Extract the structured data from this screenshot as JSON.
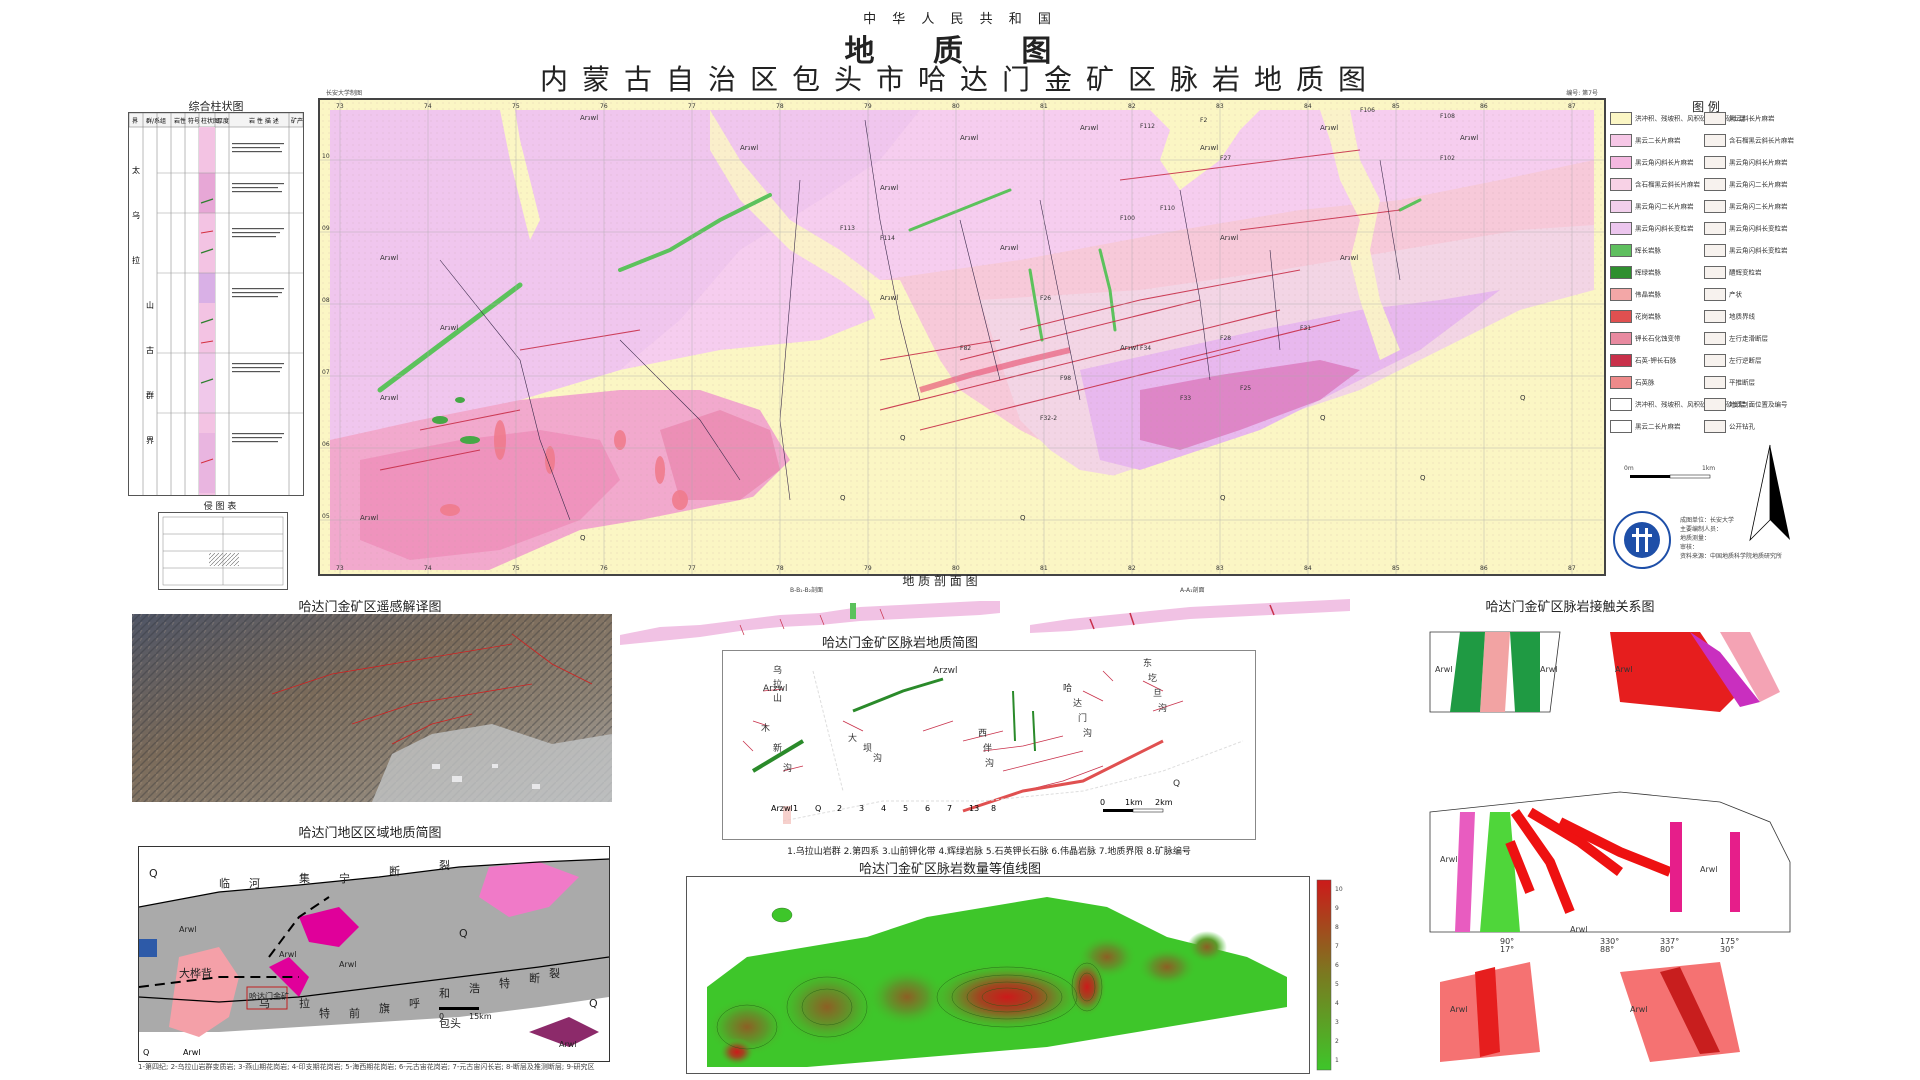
{
  "header": {
    "country": "中 华 人 民 共 和 国",
    "title": "地 质 图",
    "subtitle": "内蒙古自治区包头市哈达门金矿区脉岩地质图"
  },
  "column": {
    "title": "综合柱状图",
    "headers": [
      "界",
      "群/系",
      "组",
      "岩性",
      "符号",
      "柱状图",
      "厚度",
      "岩 性 描 述",
      "矿产"
    ],
    "units": [
      "太",
      "乌",
      "拉",
      "山",
      "古",
      "群",
      "界"
    ],
    "bottom_title": "侵 图 表"
  },
  "main_map": {
    "corner_note": "长安大学制图",
    "sheet_number": "编号: 第7号",
    "top_ticks": [
      "73",
      "74",
      "75",
      "76",
      "77",
      "78",
      "79",
      "80",
      "81",
      "82",
      "83",
      "84",
      "85",
      "86",
      "87"
    ],
    "bottom_ticks": [
      "73",
      "74",
      "75",
      "76",
      "77",
      "78",
      "79",
      "80",
      "81",
      "82",
      "83",
      "84",
      "85",
      "86",
      "87"
    ],
    "left_ticks": [
      "10",
      "09",
      "08",
      "07",
      "06",
      "05"
    ],
    "labels": {
      "q": "Q",
      "arzwl": "Ar₃wl",
      "faults": [
        "F112",
        "F2",
        "F106",
        "F108",
        "F27",
        "F113",
        "F114",
        "F110",
        "F100",
        "F31",
        "F28",
        "F26",
        "F82",
        "F98",
        "F32-2",
        "F34",
        "F33",
        "F25",
        "F102"
      ]
    }
  },
  "legend": {
    "title": "图 例",
    "left_items": [
      {
        "code": "Q",
        "label": "洪冲积、残坡积、风积砂砾石、砂土层",
        "color": "#fbf6c4"
      },
      {
        "code": "",
        "label": "黑云二长片麻岩",
        "color": "#f6c7e6"
      },
      {
        "code": "",
        "label": "黑云角闪斜长片麻岩",
        "color": "#f4b8e0"
      },
      {
        "code": "",
        "label": "含石榴黑云斜长片麻岩",
        "color": "#f8d2e6"
      },
      {
        "code": "",
        "label": "黑云角闪二长片麻岩",
        "color": "#f2cfec"
      },
      {
        "code": "",
        "label": "黑云角闪斜长变粒岩",
        "color": "#ecc6ee"
      },
      {
        "code": "",
        "label": "辉长岩脉",
        "color": "#5fbf5f"
      },
      {
        "code": "",
        "label": "辉绿岩脉",
        "color": "#2f8f2f"
      },
      {
        "code": "",
        "label": "伟晶岩脉",
        "color": "#f3a7a7"
      },
      {
        "code": "",
        "label": "花岗岩脉",
        "color": "#e05050"
      },
      {
        "code": "",
        "label": "钾长石化蚀变带",
        "color": "#e88aa0"
      },
      {
        "code": "",
        "label": "石英-钾长石脉",
        "color": "#c8304a"
      },
      {
        "code": "",
        "label": "石英脉",
        "color": "#ee8a8a"
      },
      {
        "code": "",
        "label": "洪冲积、残坡积、风积砂砾石、砂土层",
        "color": "#ffffff"
      },
      {
        "code": "",
        "label": "黑云二长片麻岩",
        "color": "#ffffff"
      }
    ],
    "right_items": [
      "黑云斜长片麻岩",
      "含石榴黑云斜长片麻岩",
      "黑云角闪斜长片麻岩",
      "黑云角闪二长片麻岩",
      "黑云角闪二长片麻岩",
      "黑云角闪斜长变粒岩",
      "黑云角闪斜长变粒岩",
      "醴辉变粒岩",
      "产状",
      "地质界线",
      "左行走滑断层",
      "左行逆断层",
      "平推断层",
      "地质剖面位置及编号",
      "公开钻孔"
    ],
    "scale_left": "0m",
    "scale_right": "1km",
    "credits": [
      "成图单位：长安大学",
      "主要编制人员：",
      "地质测量：",
      "审核：",
      "资料来源：中国地质科学院地质研究所"
    ]
  },
  "section": {
    "title": "地 质 剖 面 图",
    "left_label": "B-B₁-B₂剖面",
    "right_label": "A-A₁剖面"
  },
  "remote": {
    "title": "哈达门金矿区遥感解译图"
  },
  "dike_map": {
    "title": "哈达门金矿区脉岩地质简图",
    "labels": [
      "乌",
      "拉",
      "山",
      "木",
      "新",
      "沟",
      "大",
      "坝",
      "沟",
      "西",
      "伴",
      "沟",
      "哈",
      "达",
      "门",
      "沟",
      "东",
      "圪",
      "旦",
      "沟",
      "Arzwl",
      "Arzwl",
      "Q"
    ],
    "legend": [
      "Arzwl",
      "1",
      "Q",
      "2",
      "3",
      "4",
      "5",
      "6",
      "7",
      "13",
      "8"
    ],
    "scale": [
      "0",
      "1km",
      "2km"
    ],
    "caption": "1.乌拉山岩群  2.第四系  3.山前钾化带  4.辉绿岩脉  5.石英钾长石脉  6.伟晶岩脉  7.地质界限  8.矿脉编号"
  },
  "contour": {
    "title": "哈达门金矿区脉岩数量等值线图",
    "scale_values": [
      "10",
      "9",
      "8",
      "7",
      "6",
      "5",
      "4",
      "3",
      "2",
      "1"
    ]
  },
  "region": {
    "title": "哈达门地区区域地质简图",
    "labels": [
      "Q",
      "临",
      "河",
      "集",
      "宁",
      "断",
      "裂",
      "Arwl",
      "Arwl",
      "Arwl",
      "大桦背",
      "乌",
      "拉",
      "特",
      "前",
      "旗",
      "呼",
      "和",
      "浩",
      "特",
      "断",
      "裂",
      "Q",
      "Q",
      "包头",
      "Arwl",
      "哈达门金矿"
    ],
    "scale": [
      "0",
      "15km"
    ],
    "legend": [
      "Q",
      "Arwl"
    ],
    "caption": "1-第四纪; 2-乌拉山岩群变质岩; 3-燕山期花岗岩; 4-印支期花岗岩; 5-海西期花岗岩; 6-元古宙花岗岩; 7-元古宙闪长岩; 8-断层及推测断层; 9-研究区"
  },
  "contact": {
    "title": "哈达门金矿区脉岩接触关系图",
    "labels": [
      "Arwl",
      "Arwl",
      "Arwl",
      "Arwl",
      "Arwl",
      "Arwl",
      "Arwl",
      "Arwl",
      "90°",
      "17°",
      "330°",
      "88°",
      "337°",
      "80°",
      "175°",
      "30°"
    ]
  }
}
